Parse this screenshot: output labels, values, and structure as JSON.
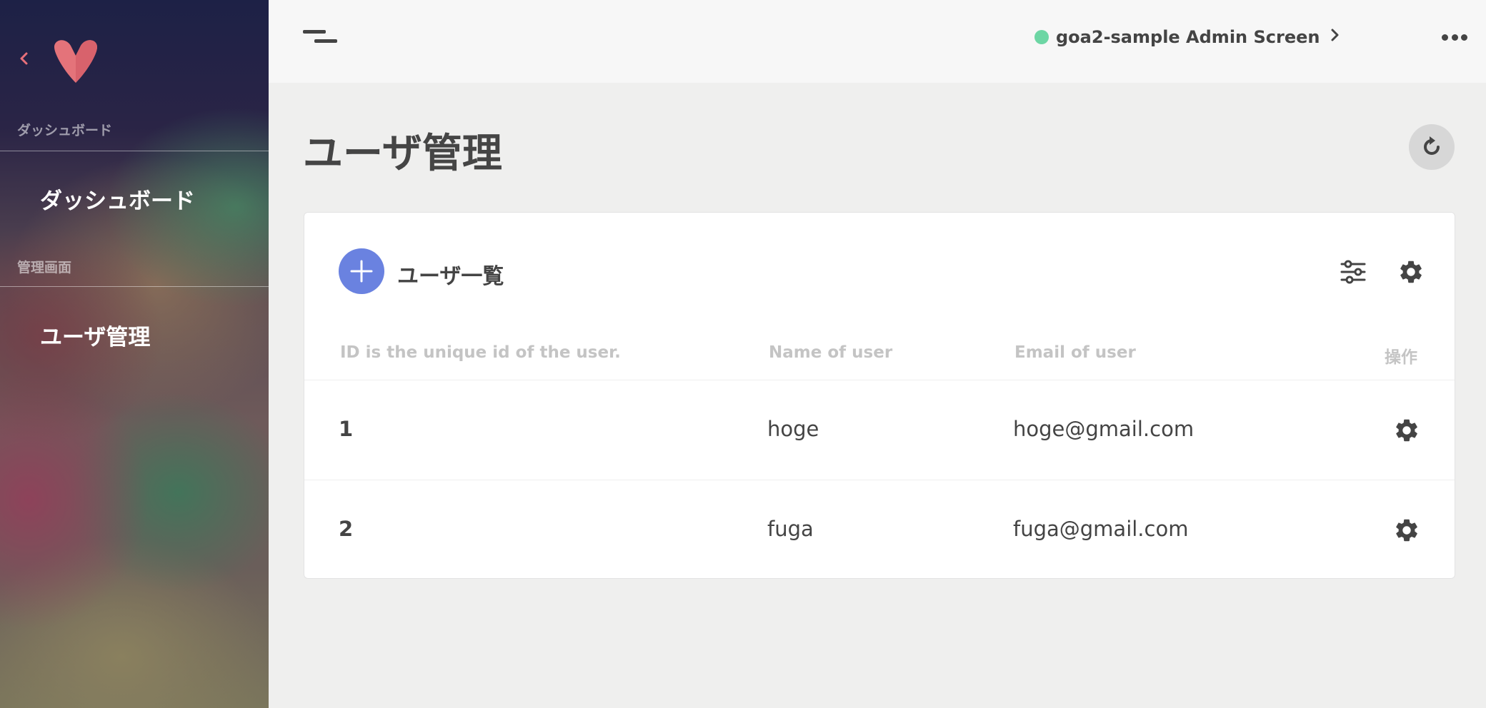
{
  "sidebar": {
    "back_icon": "chevron-left-icon",
    "logo_icon": "v-logo-icon",
    "sections": [
      {
        "label": "ダッシュボード",
        "items": [
          {
            "label": "ダッシュボード"
          }
        ]
      },
      {
        "label": "管理画面",
        "items": [
          {
            "label": "ユーザ管理"
          }
        ]
      }
    ]
  },
  "topbar": {
    "app_title": "goa2-sample Admin Screen",
    "status_color": "#6dd6a4",
    "chevron_icon": "chevron-right-icon",
    "more_icon": "more-horizontal-icon"
  },
  "main": {
    "page_title": "ユーザ管理",
    "refresh_icon": "refresh-icon"
  },
  "card": {
    "title": "ユーザ一覧",
    "add_icon": "plus-icon",
    "accent_color": "#6a82e0",
    "columns": [
      "ID is the unique id of the user.",
      "Name of user",
      "Email of user",
      "操作"
    ],
    "rows": [
      {
        "id": "1",
        "name": "hoge",
        "email": "hoge@gmail.com"
      },
      {
        "id": "2",
        "name": "fuga",
        "email": "fuga@gmail.com"
      }
    ]
  }
}
